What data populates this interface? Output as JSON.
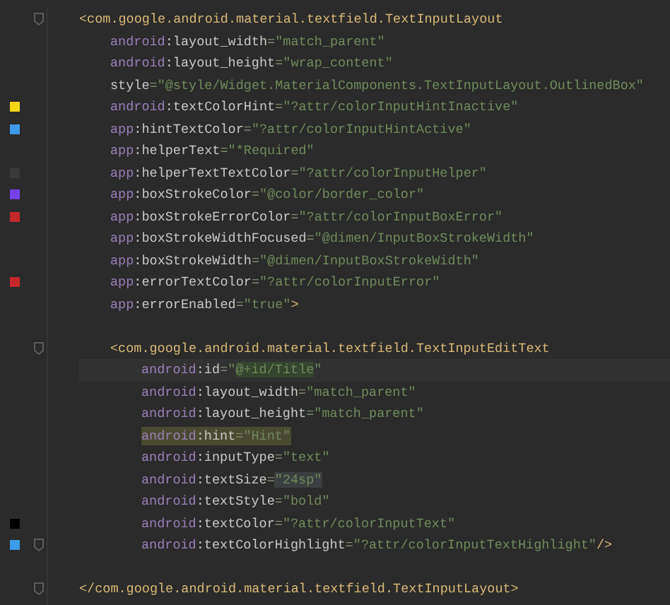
{
  "lines": [
    {
      "kind": "code",
      "fold": true,
      "tokens": [
        {
          "kind": "t",
          "text": "<com.google.android.material.textfield.TextInputLayout"
        }
      ],
      "children": [
        {
          "kind": "code",
          "tokens": [
            {
              "kind": "n",
              "text": "android"
            },
            {
              "kind": "p",
              "text": ":"
            },
            {
              "kind": "a",
              "text": "layout_width"
            },
            {
              "kind": "e",
              "text": "="
            },
            {
              "kind": "v",
              "text": "\"match_parent\""
            }
          ]
        },
        {
          "kind": "code",
          "tokens": [
            {
              "kind": "n",
              "text": "android"
            },
            {
              "kind": "p",
              "text": ":"
            },
            {
              "kind": "a",
              "text": "layout_height"
            },
            {
              "kind": "e",
              "text": "="
            },
            {
              "kind": "v",
              "text": "\"wrap_content\""
            }
          ]
        },
        {
          "kind": "code",
          "tokens": [
            {
              "kind": "a",
              "text": "style"
            },
            {
              "kind": "e",
              "text": "="
            },
            {
              "kind": "v",
              "text": "\"@style/Widget.MaterialComponents.TextInputLayout.OutlinedBox\""
            }
          ]
        },
        {
          "kind": "code",
          "color": "#f5d416",
          "tokens": [
            {
              "kind": "n",
              "text": "android"
            },
            {
              "kind": "p",
              "text": ":"
            },
            {
              "kind": "a",
              "text": "textColorHint"
            },
            {
              "kind": "e",
              "text": "="
            },
            {
              "kind": "v",
              "text": "\"?attr/colorInputHintInactive\""
            }
          ]
        },
        {
          "kind": "code",
          "color": "#3d9be9",
          "tokens": [
            {
              "kind": "n",
              "text": "app"
            },
            {
              "kind": "p",
              "text": ":"
            },
            {
              "kind": "a",
              "text": "hintTextColor"
            },
            {
              "kind": "e",
              "text": "="
            },
            {
              "kind": "v",
              "text": "\"?attr/colorInputHintActive\""
            }
          ]
        },
        {
          "kind": "code",
          "tokens": [
            {
              "kind": "n",
              "text": "app"
            },
            {
              "kind": "p",
              "text": ":"
            },
            {
              "kind": "a",
              "text": "helperText"
            },
            {
              "kind": "e",
              "text": "="
            },
            {
              "kind": "v",
              "text": "\"*Required\""
            }
          ]
        },
        {
          "kind": "code",
          "color": "#3a3a3a",
          "tokens": [
            {
              "kind": "n",
              "text": "app"
            },
            {
              "kind": "p",
              "text": ":"
            },
            {
              "kind": "a",
              "text": "helperTextTextColor"
            },
            {
              "kind": "e",
              "text": "="
            },
            {
              "kind": "v",
              "text": "\"?attr/colorInputHelper\""
            }
          ]
        },
        {
          "kind": "code",
          "color": "#7442e8",
          "tokens": [
            {
              "kind": "n",
              "text": "app"
            },
            {
              "kind": "p",
              "text": ":"
            },
            {
              "kind": "a",
              "text": "boxStrokeColor"
            },
            {
              "kind": "e",
              "text": "="
            },
            {
              "kind": "v",
              "text": "\"@color/border_color\""
            }
          ]
        },
        {
          "kind": "code",
          "color": "#c5282b",
          "tokens": [
            {
              "kind": "n",
              "text": "app"
            },
            {
              "kind": "p",
              "text": ":"
            },
            {
              "kind": "a",
              "text": "boxStrokeErrorColor"
            },
            {
              "kind": "e",
              "text": "="
            },
            {
              "kind": "v",
              "text": "\"?attr/colorInputBoxError\""
            }
          ]
        },
        {
          "kind": "code",
          "tokens": [
            {
              "kind": "n",
              "text": "app"
            },
            {
              "kind": "p",
              "text": ":"
            },
            {
              "kind": "a",
              "text": "boxStrokeWidthFocused"
            },
            {
              "kind": "e",
              "text": "="
            },
            {
              "kind": "v",
              "text": "\"@dimen/InputBoxStrokeWidth\""
            }
          ]
        },
        {
          "kind": "code",
          "tokens": [
            {
              "kind": "n",
              "text": "app"
            },
            {
              "kind": "p",
              "text": ":"
            },
            {
              "kind": "a",
              "text": "boxStrokeWidth"
            },
            {
              "kind": "e",
              "text": "="
            },
            {
              "kind": "v",
              "text": "\"@dimen/InputBoxStrokeWidth\""
            }
          ]
        },
        {
          "kind": "code",
          "color": "#c5282b",
          "tokens": [
            {
              "kind": "n",
              "text": "app"
            },
            {
              "kind": "p",
              "text": ":"
            },
            {
              "kind": "a",
              "text": "errorTextColor"
            },
            {
              "kind": "e",
              "text": "="
            },
            {
              "kind": "v",
              "text": "\"?attr/colorInputError\""
            }
          ]
        },
        {
          "kind": "code",
          "tokens": [
            {
              "kind": "n",
              "text": "app"
            },
            {
              "kind": "p",
              "text": ":"
            },
            {
              "kind": "a",
              "text": "errorEnabled"
            },
            {
              "kind": "e",
              "text": "="
            },
            {
              "kind": "v",
              "text": "\"true\""
            },
            {
              "kind": "t",
              "text": ">"
            }
          ]
        },
        {
          "kind": "blank"
        },
        {
          "kind": "code",
          "fold": true,
          "tokens": [
            {
              "kind": "t",
              "text": "<com.google.android.material.textfield.TextInputEditText"
            }
          ],
          "children": [
            {
              "kind": "code",
              "current": true,
              "tokens": [
                {
                  "kind": "n",
                  "text": "android"
                },
                {
                  "kind": "p",
                  "text": ":"
                },
                {
                  "kind": "a",
                  "text": "id"
                },
                {
                  "kind": "e",
                  "text": "="
                },
                {
                  "kind": "v",
                  "text": "\""
                },
                {
                  "kind": "v",
                  "text": "@+id/Title",
                  "usage_highlight": true
                },
                {
                  "kind": "v",
                  "text": "\""
                }
              ]
            },
            {
              "kind": "code",
              "tokens": [
                {
                  "kind": "n",
                  "text": "android"
                },
                {
                  "kind": "p",
                  "text": ":"
                },
                {
                  "kind": "a",
                  "text": "layout_width"
                },
                {
                  "kind": "e",
                  "text": "="
                },
                {
                  "kind": "v",
                  "text": "\"match_parent\""
                }
              ]
            },
            {
              "kind": "code",
              "tokens": [
                {
                  "kind": "n",
                  "text": "android"
                },
                {
                  "kind": "p",
                  "text": ":"
                },
                {
                  "kind": "a",
                  "text": "layout_height"
                },
                {
                  "kind": "e",
                  "text": "="
                },
                {
                  "kind": "v",
                  "text": "\"match_parent\""
                }
              ]
            },
            {
              "kind": "code",
              "search_highlight": true,
              "tokens": [
                {
                  "kind": "n",
                  "text": "android"
                },
                {
                  "kind": "p",
                  "text": ":"
                },
                {
                  "kind": "a",
                  "text": "hint"
                },
                {
                  "kind": "e",
                  "text": "="
                },
                {
                  "kind": "v",
                  "text": "\"Hint\""
                }
              ]
            },
            {
              "kind": "code",
              "tokens": [
                {
                  "kind": "n",
                  "text": "android"
                },
                {
                  "kind": "p",
                  "text": ":"
                },
                {
                  "kind": "a",
                  "text": "inputType"
                },
                {
                  "kind": "e",
                  "text": "="
                },
                {
                  "kind": "v",
                  "text": "\"text\""
                }
              ]
            },
            {
              "kind": "code",
              "tokens": [
                {
                  "kind": "n",
                  "text": "android"
                },
                {
                  "kind": "p",
                  "text": ":"
                },
                {
                  "kind": "a",
                  "text": "textSize"
                },
                {
                  "kind": "e",
                  "text": "="
                },
                {
                  "kind": "v",
                  "text": "\"24sp\"",
                  "folded": true
                }
              ]
            },
            {
              "kind": "code",
              "tokens": [
                {
                  "kind": "n",
                  "text": "android"
                },
                {
                  "kind": "p",
                  "text": ":"
                },
                {
                  "kind": "a",
                  "text": "textStyle"
                },
                {
                  "kind": "e",
                  "text": "="
                },
                {
                  "kind": "v",
                  "text": "\"bold\""
                }
              ]
            },
            {
              "kind": "code",
              "color": "#000000",
              "tokens": [
                {
                  "kind": "n",
                  "text": "android"
                },
                {
                  "kind": "p",
                  "text": ":"
                },
                {
                  "kind": "a",
                  "text": "textColor"
                },
                {
                  "kind": "e",
                  "text": "="
                },
                {
                  "kind": "v",
                  "text": "\"?attr/colorInputText\""
                }
              ]
            },
            {
              "kind": "code",
              "color": "#3d9be9",
              "fold": true,
              "tokens": [
                {
                  "kind": "n",
                  "text": "android"
                },
                {
                  "kind": "p",
                  "text": ":"
                },
                {
                  "kind": "a",
                  "text": "textColorHighlight"
                },
                {
                  "kind": "e",
                  "text": "="
                },
                {
                  "kind": "v",
                  "text": "\"?attr/colorInputTextHighlight\""
                },
                {
                  "kind": "t",
                  "text": "/>"
                }
              ]
            }
          ]
        }
      ]
    },
    {
      "kind": "blank"
    },
    {
      "kind": "code",
      "fold": true,
      "tokens": [
        {
          "kind": "t",
          "text": "</com.google.android.material.textfield.TextInputLayout>"
        }
      ]
    }
  ]
}
